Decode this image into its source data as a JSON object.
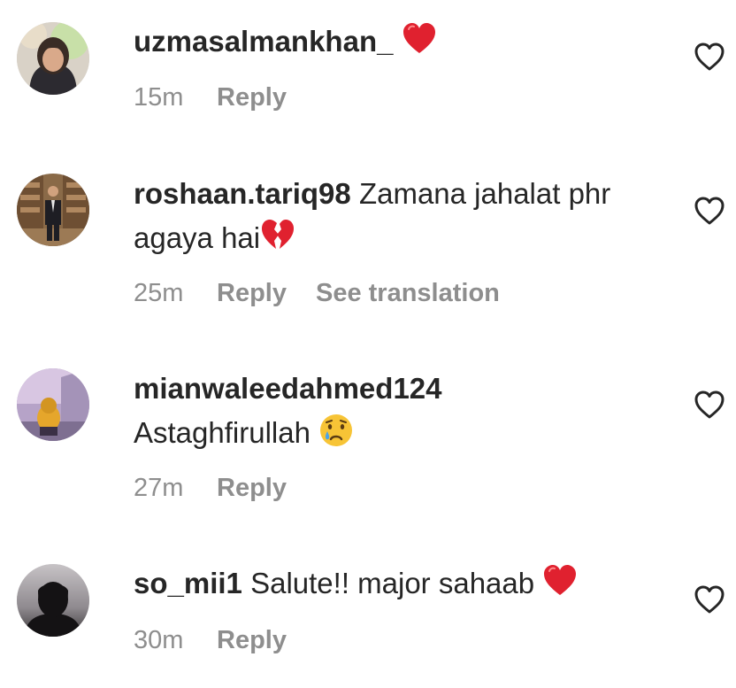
{
  "comments": [
    {
      "username": "uzmasalmankhan_",
      "text": "",
      "emoji": "red-heart",
      "time": "15m",
      "reply_label": "Reply"
    },
    {
      "username": "roshaan.tariq98",
      "text": "Zamana jahalat phr agaya hai",
      "emoji": "broken-heart",
      "time": "25m",
      "reply_label": "Reply",
      "translation_label": "See translation"
    },
    {
      "username": "mianwaleedahmed124",
      "text": "Astaghfirullah",
      "emoji": "crying-face",
      "time": "27m",
      "reply_label": "Reply"
    },
    {
      "username": "so_mii1",
      "text": "Salute!! major sahaab",
      "emoji": "red-heart",
      "time": "30m",
      "reply_label": "Reply"
    }
  ],
  "icons": {
    "like": "heart-outline-icon"
  },
  "colors": {
    "text": "#262626",
    "secondary": "#8e8e8e",
    "heart_red": "#e0212f",
    "emoji_yellow": "#f7c436"
  }
}
